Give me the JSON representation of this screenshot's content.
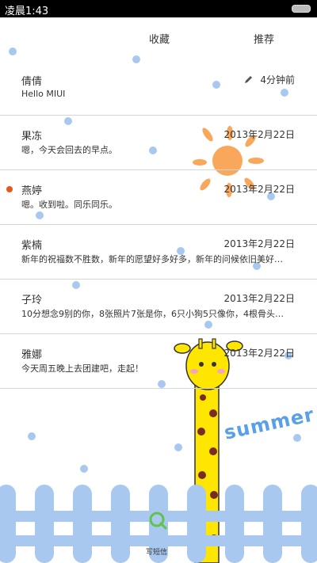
{
  "status": {
    "time": "凌晨1:43"
  },
  "tabs": {
    "favorites": "收藏",
    "recommend": "推荐"
  },
  "conversations": [
    {
      "name": "倩倩",
      "preview": "Hello MIUI",
      "time": "4分钟前",
      "unread": false,
      "draft": true
    },
    {
      "name": "果冻",
      "preview": "嗯，今天会回去的早点。",
      "time": "2013年2月22日",
      "unread": false,
      "draft": false
    },
    {
      "name": "燕婷",
      "preview": "嗯。收到啦。同乐同乐。",
      "time": "2013年2月22日",
      "unread": true,
      "draft": false
    },
    {
      "name": "紫楠",
      "preview": "新年的祝福数不胜数，新年的愿望好多好多，新年的问候依旧美好…",
      "time": "2013年2月22日",
      "unread": false,
      "draft": false
    },
    {
      "name": "子玲",
      "preview": "10分想念9别的你，8张照片7张是你，6只小狗5只像你，4根骨头…",
      "time": "2013年2月22日",
      "unread": false,
      "draft": false
    },
    {
      "name": "雅娜",
      "preview": "今天周五晚上去团建吧，走起！",
      "time": "2013年2月22日",
      "unread": false,
      "draft": false
    }
  ],
  "theme": {
    "summer_text": "summer",
    "accent": "#e55a1c",
    "dot_color": "#a9c8f0",
    "fence_color": "#a9c8f0"
  },
  "footer": {
    "compose_label": "写短信"
  },
  "icons": {
    "pencil": "pencil-icon",
    "compose": "compose-icon"
  }
}
